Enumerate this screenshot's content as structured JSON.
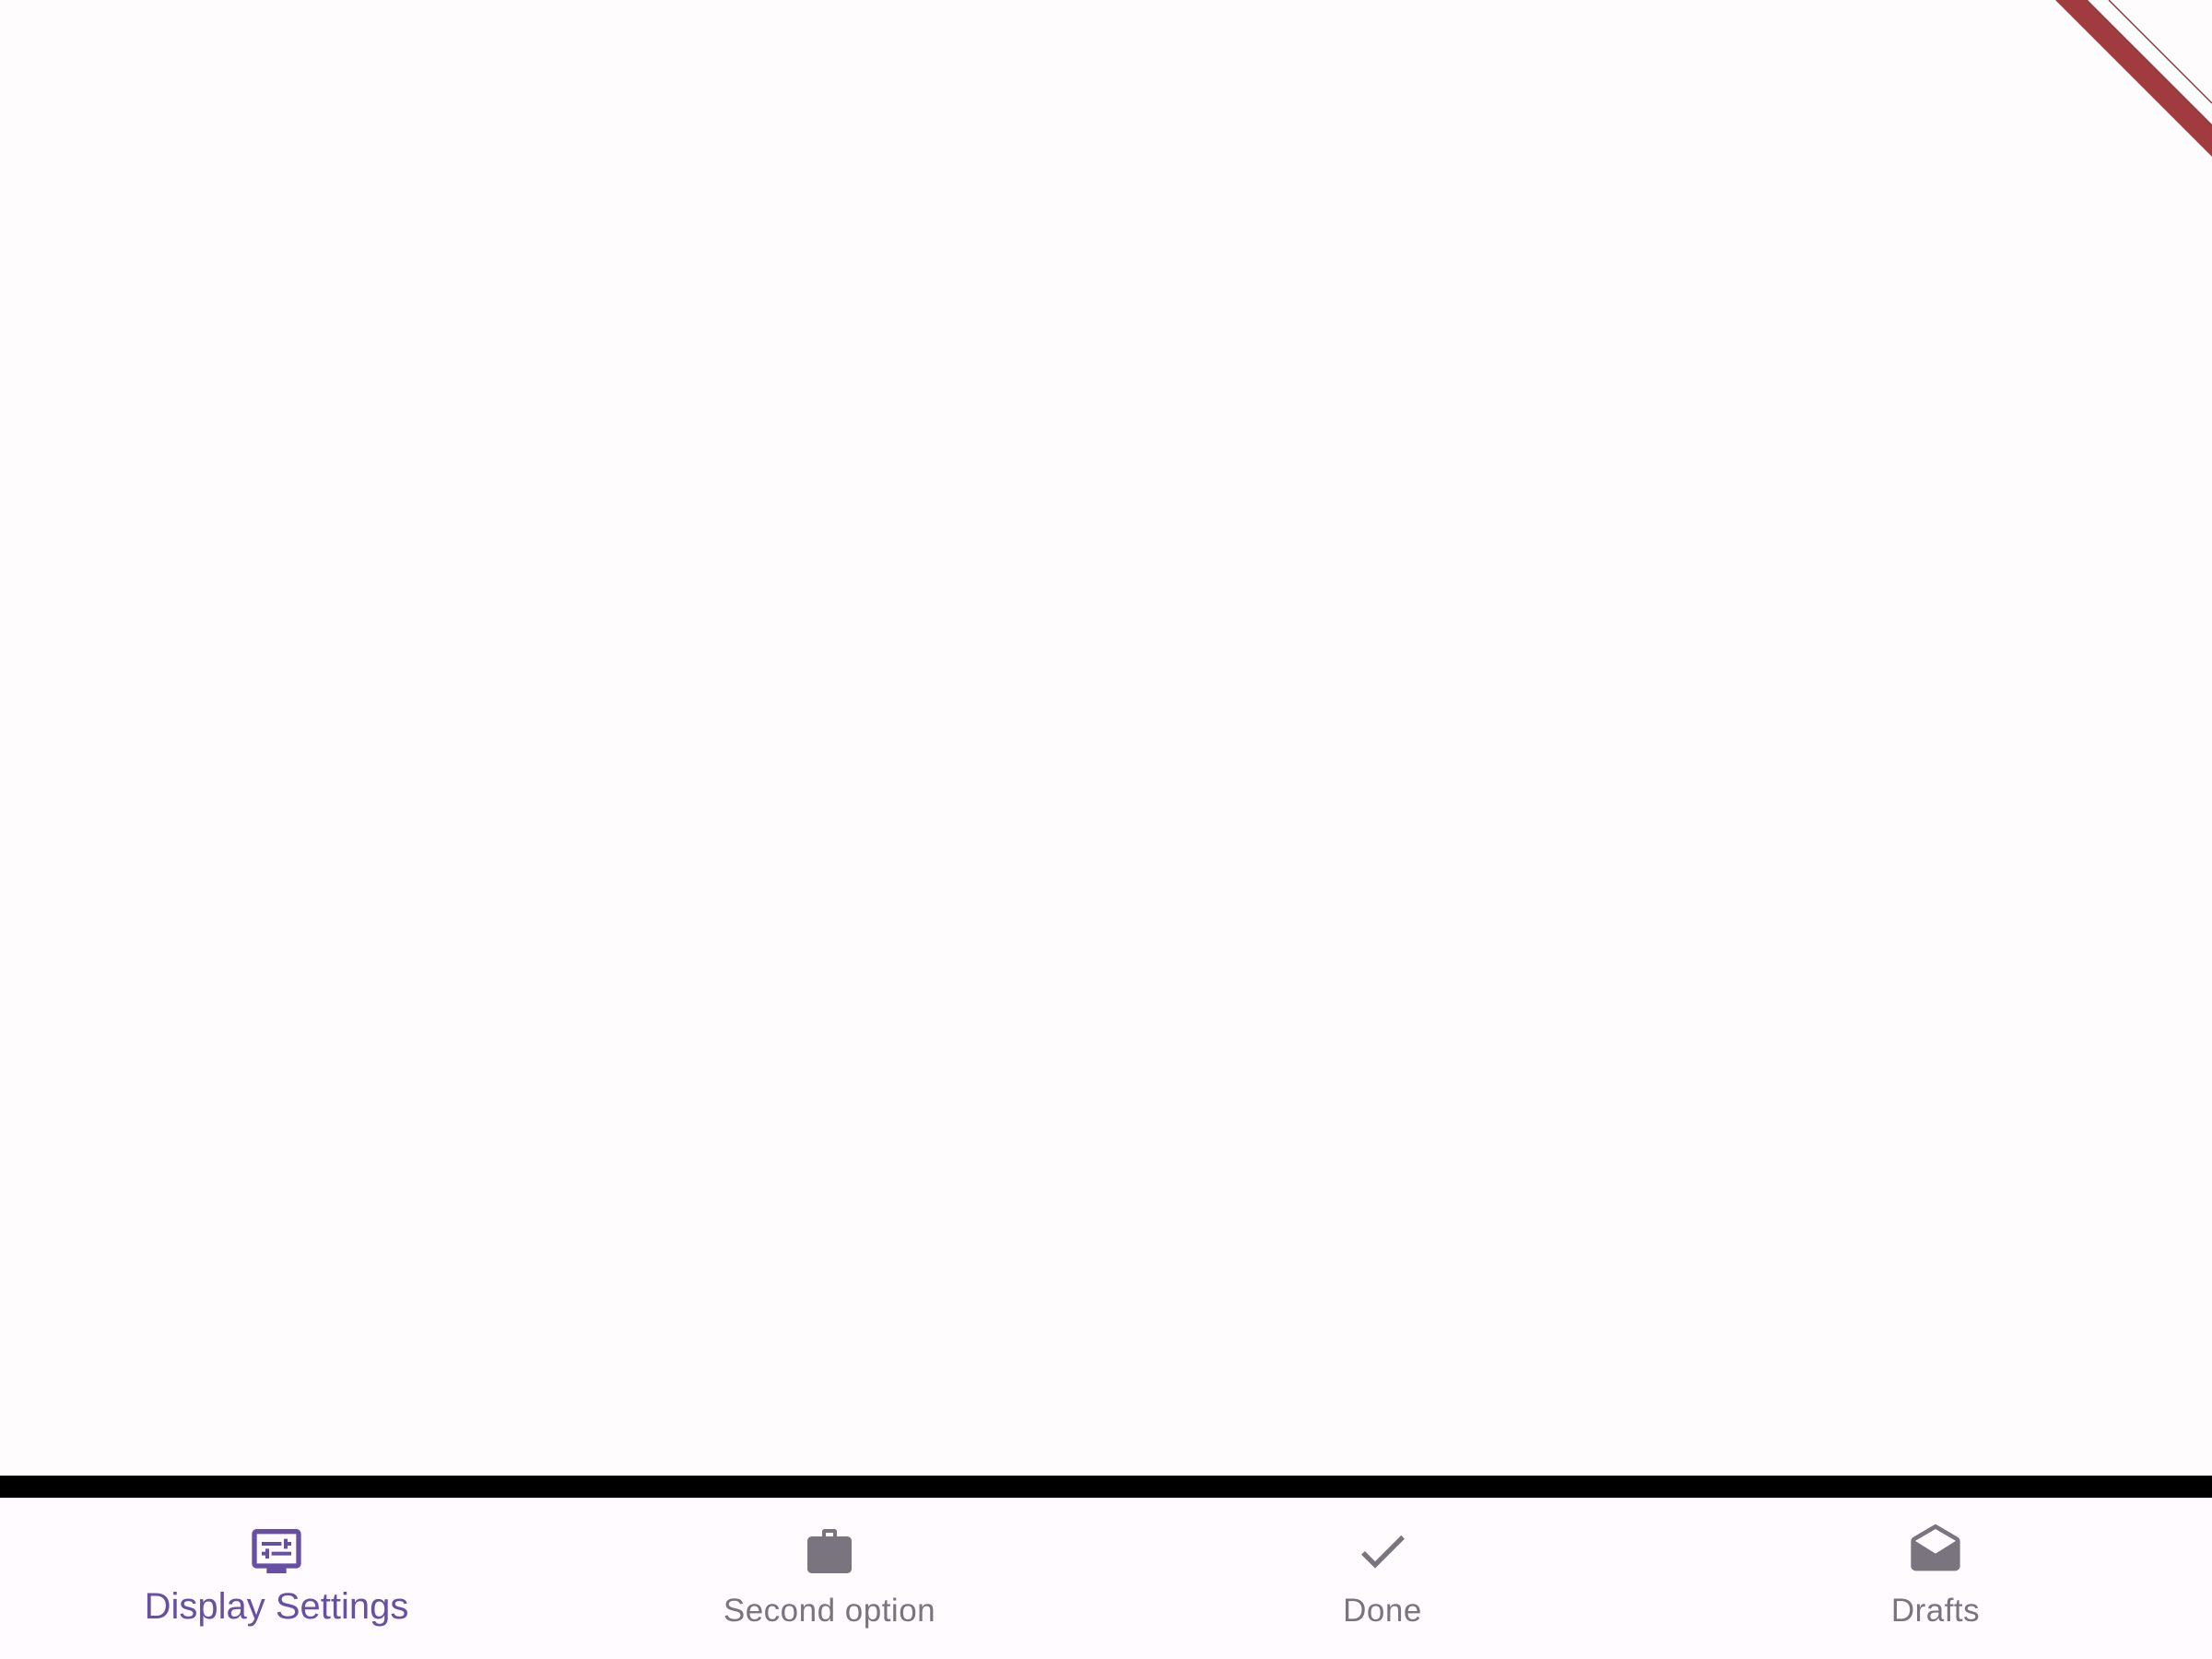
{
  "colors": {
    "background": "#fffbfe",
    "active": "#6750a4",
    "inactive": "#79747e",
    "divider": "#000000",
    "banner": "#a03c3f"
  },
  "bottom_nav": {
    "items": [
      {
        "label": "Display Settings",
        "icon": "display-settings-icon",
        "active": true
      },
      {
        "label": "Second option",
        "icon": "briefcase-icon",
        "active": false
      },
      {
        "label": "Done",
        "icon": "check-icon",
        "active": false
      },
      {
        "label": "Drafts",
        "icon": "drafts-icon",
        "active": false
      }
    ]
  }
}
